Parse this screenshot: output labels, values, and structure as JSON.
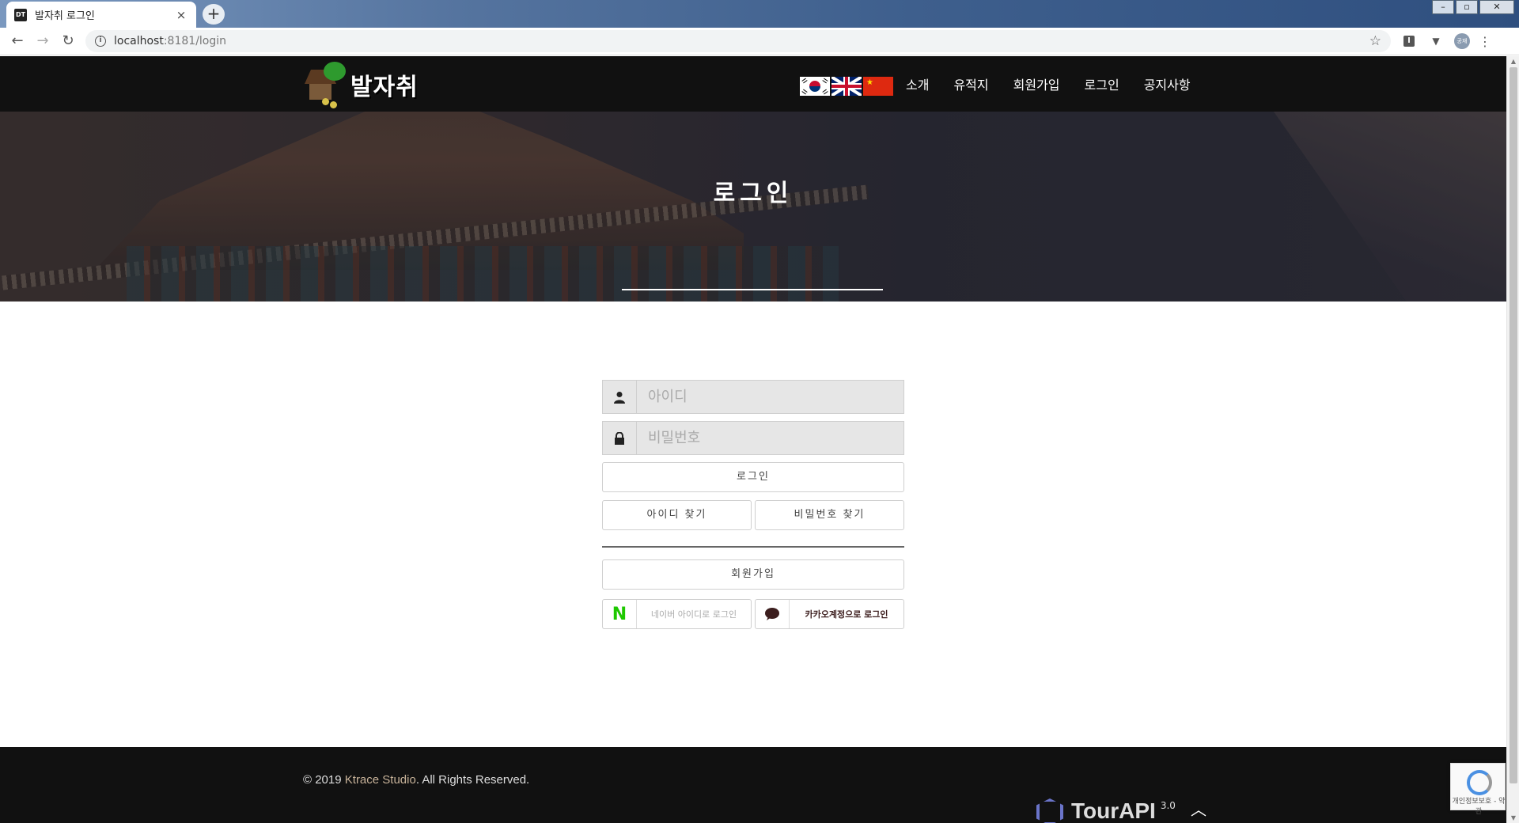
{
  "browser": {
    "tab_favicon": "DT",
    "tab_title": "발자취 로그인",
    "tab_close": "×",
    "new_tab": "+",
    "url_host": "localhost",
    "url_path": ":8181/login",
    "avatar_text": "공재",
    "window_controls": [
      "–",
      "▫",
      "✕"
    ]
  },
  "header": {
    "logo_text": "발자취",
    "nav": [
      "소개",
      "유적지",
      "회원가입",
      "로그인",
      "공지사항"
    ]
  },
  "hero": {
    "title": "로그인"
  },
  "form": {
    "id_placeholder": "아이디",
    "password_placeholder": "비밀번호",
    "login_button": "로그인",
    "find_id_button": "아이디 찾기",
    "find_password_button": "비밀번호 찾기",
    "signup_button": "회원가입",
    "naver_icon": "N",
    "naver_label": "네이버 아이디로 로그인",
    "kakao_label": "카카오계정으로 로그인"
  },
  "footer": {
    "copyright_prefix": "© 2019 ",
    "studio": "Ktrace Studio",
    "copyright_suffix": ". All Rights Reserved.",
    "tourapi_name": "TourAPI",
    "tourapi_version": "3.0",
    "recaptcha_text": "개인정보보호 - 약관"
  },
  "colors": {
    "header_bg": "#111111",
    "naver_green": "#1ec800",
    "kakao_brown": "#3c1e1e"
  }
}
